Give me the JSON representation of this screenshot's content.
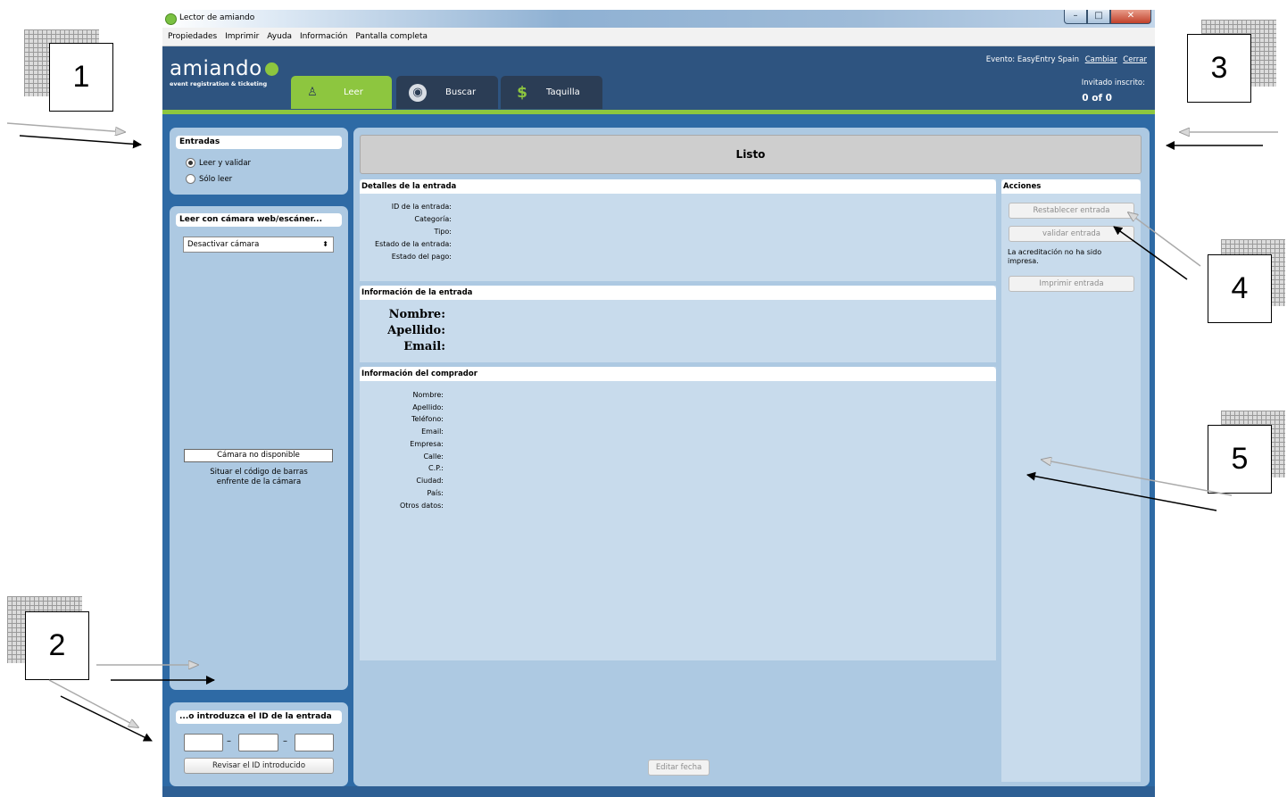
{
  "window": {
    "title": "Lector de amiando"
  },
  "menu": [
    "Propiedades",
    "Imprimir",
    "Ayuda",
    "Información",
    "Pantalla completa"
  ],
  "header": {
    "logo": "amiando",
    "logo_sub": "event registration & ticketing",
    "tabs": [
      {
        "label": "Leer",
        "icon": "stamp-icon",
        "active": true
      },
      {
        "label": "Buscar",
        "icon": "magnifier-icon"
      },
      {
        "label": "Taquilla",
        "icon": "dollar-icon"
      }
    ],
    "event_label": "Evento: EasyEntry Spain",
    "change_link": "Cambiar",
    "close_link": "Cerrar",
    "invited_label": "Invitado inscrito:",
    "invited_count": "0 of 0"
  },
  "left": {
    "tickets_title": "Entradas",
    "radio_validate": "Leer y validar",
    "radio_read": "Sólo leer",
    "camera_title": "Leer con cámara web/escáner...",
    "camera_select": "Desactivar cámara",
    "camera_status": "Cámara no disponible",
    "camera_hint_1": "Situar el código de barras",
    "camera_hint_2": "enfrente de la cámara",
    "id_title": "...o introduzca el ID de la entrada",
    "id_separator": "–",
    "check_button": "Revisar el ID introducido"
  },
  "main": {
    "status": "Listo",
    "details_title": "Detalles de la entrada",
    "details_fields": [
      "ID de la entrada:",
      "Categoría:",
      "Tipo:",
      "Estado de la entrada:",
      "Estado del pago:"
    ],
    "ticket_info_title": "Información de la entrada",
    "ticket_info_fields": [
      "Nombre:",
      "Apellido:",
      "Email:"
    ],
    "buyer_title": "Información del comprador",
    "buyer_fields": [
      "Nombre:",
      "Apellido:",
      "Teléfono:",
      "Email:",
      "Empresa:",
      "Calle:",
      "C.P.:",
      "Ciudad:",
      "País:",
      "Otros datos:"
    ],
    "edit_date_button": "Editar fecha"
  },
  "actions": {
    "title": "Acciones",
    "reset_button": "Restablecer entrada",
    "validate_button": "validar entrada",
    "note": "La acreditación no ha sido impresa.",
    "print_button": "Imprimir entrada"
  },
  "annotations": [
    "1",
    "2",
    "3",
    "4",
    "5"
  ],
  "colors": {
    "brand_green": "#8dc63f",
    "header_blue": "#2e5480",
    "panel_blue": "#adc9e2"
  }
}
